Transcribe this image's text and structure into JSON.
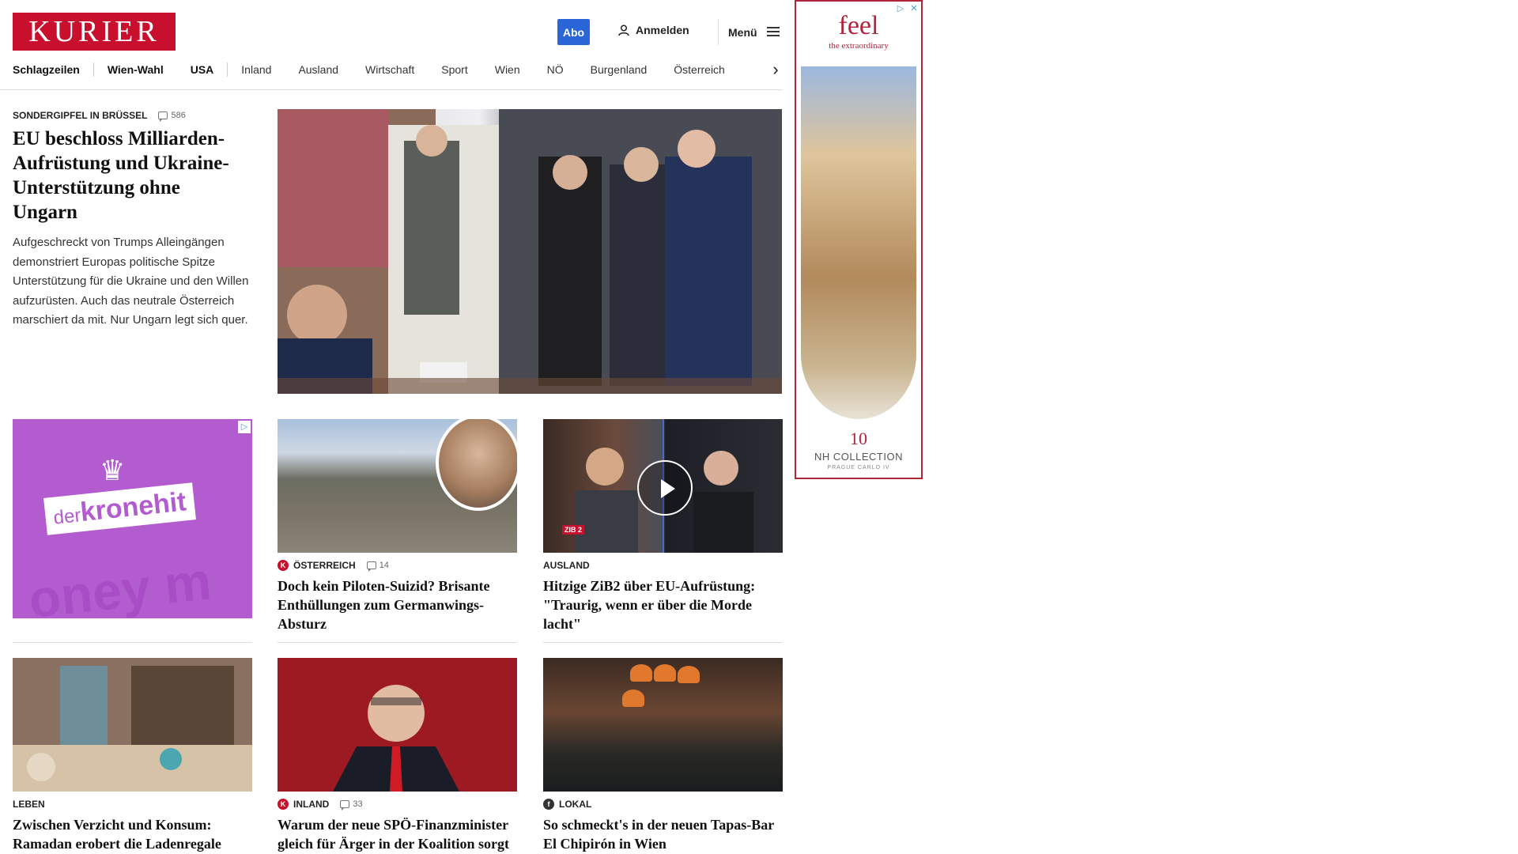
{
  "header": {
    "logo_text": "KURIER",
    "abo_label": "Abo",
    "login_label": "Anmelden",
    "menu_label": "Menü"
  },
  "nav": {
    "items": [
      "Schlagzeilen",
      "Wien-Wahl",
      "USA",
      "Inland",
      "Ausland",
      "Wirtschaft",
      "Sport",
      "Wien",
      "NÖ",
      "Burgenland",
      "Österreich"
    ]
  },
  "lead": {
    "kicker": "SONDERGIPFEL IN BRÜSSEL",
    "comments": "586",
    "title": "EU beschloss Milliarden-Aufrüstung und Ukraine-Unterstützung ohne Ungarn",
    "teaser": "Aufgeschreckt von Trumps Alleingängen demonstriert Europas politische Spitze Unterstützung für die Ukraine und den Willen aufzurüsten. Auch das neutrale Österreich marschiert da mit. Nur Ungarn legt sich quer."
  },
  "ads": {
    "left": {
      "brand_prefix": "der",
      "brand_name": "kronehit",
      "bg_text": "oney m"
    },
    "right": {
      "headline": "feel",
      "subline": "the extraordinary",
      "anniversary": "10",
      "collection": "NH COLLECTION",
      "location": "PRAGUE CARLO IV"
    }
  },
  "cards": [
    {
      "kicker": "ÖSTERREICH",
      "badge": "K",
      "comments": "14",
      "title": "Doch kein Piloten-Suizid? Brisante Enthüllungen zum Germanwings-Absturz"
    },
    {
      "kicker": "AUSLAND",
      "title": "Hitzige ZiB2 über EU-Aufrüstung: \"Traurig, wenn er über die Morde lacht\"",
      "video_logo": "ZIB 2"
    },
    {
      "kicker": "LEBEN",
      "title": "Zwischen Verzicht und Konsum: Ramadan erobert die Ladenregale"
    },
    {
      "kicker": "INLAND",
      "badge": "K",
      "comments": "33",
      "title": "Warum der neue SPÖ-Finanzminister gleich für Ärger in der Koalition sorgt"
    },
    {
      "kicker": "LOKAL",
      "badge": "f",
      "title": "So schmeckt's in der neuen Tapas-Bar El Chipirón in Wien"
    }
  ]
}
